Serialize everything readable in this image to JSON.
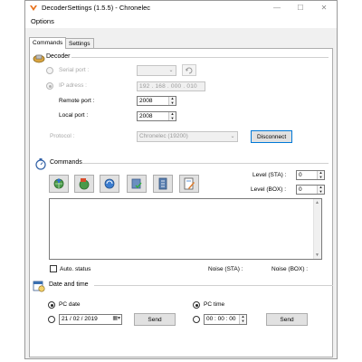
{
  "window": {
    "title": "DecoderSettings (1.5.5) - Chronelec",
    "minimize": "—",
    "maximize": "☐",
    "close": "✕"
  },
  "menu": {
    "options": "Options"
  },
  "tabs": [
    {
      "label": "Commands"
    },
    {
      "label": "Settings"
    }
  ],
  "decoder": {
    "title": "Decoder",
    "serial_port_label": "Serial port :",
    "ip_address_label": "IP adress :",
    "ip_address_value": "192 . 168 . 000 . 010",
    "remote_port_label": "Remote port :",
    "remote_port_value": "2008",
    "local_port_label": "Local port :",
    "local_port_value": "2008",
    "protocol_label": "Protocol :",
    "protocol_value": "Chronelec (19200)",
    "disconnect_label": "Disconnect"
  },
  "commands": {
    "title": "Commands",
    "level_sta_label": "Level (STA) :",
    "level_sta_value": "0",
    "level_box_label": "Level (BOX) :",
    "level_box_value": "0",
    "auto_status_label": "Auto. status",
    "noise_sta_label": "Noise (STA) :",
    "noise_box_label": "Noise (BOX) :"
  },
  "datetime": {
    "title": "Date and time",
    "pc_date_label": "PC date",
    "date_value": "21 / 02 / 2019",
    "pc_time_label": "PC time",
    "time_value": "00 : 00 : 00",
    "send_label": "Send"
  },
  "colors": {
    "accent": "#0078d7",
    "app_icon": "#e8701a"
  }
}
